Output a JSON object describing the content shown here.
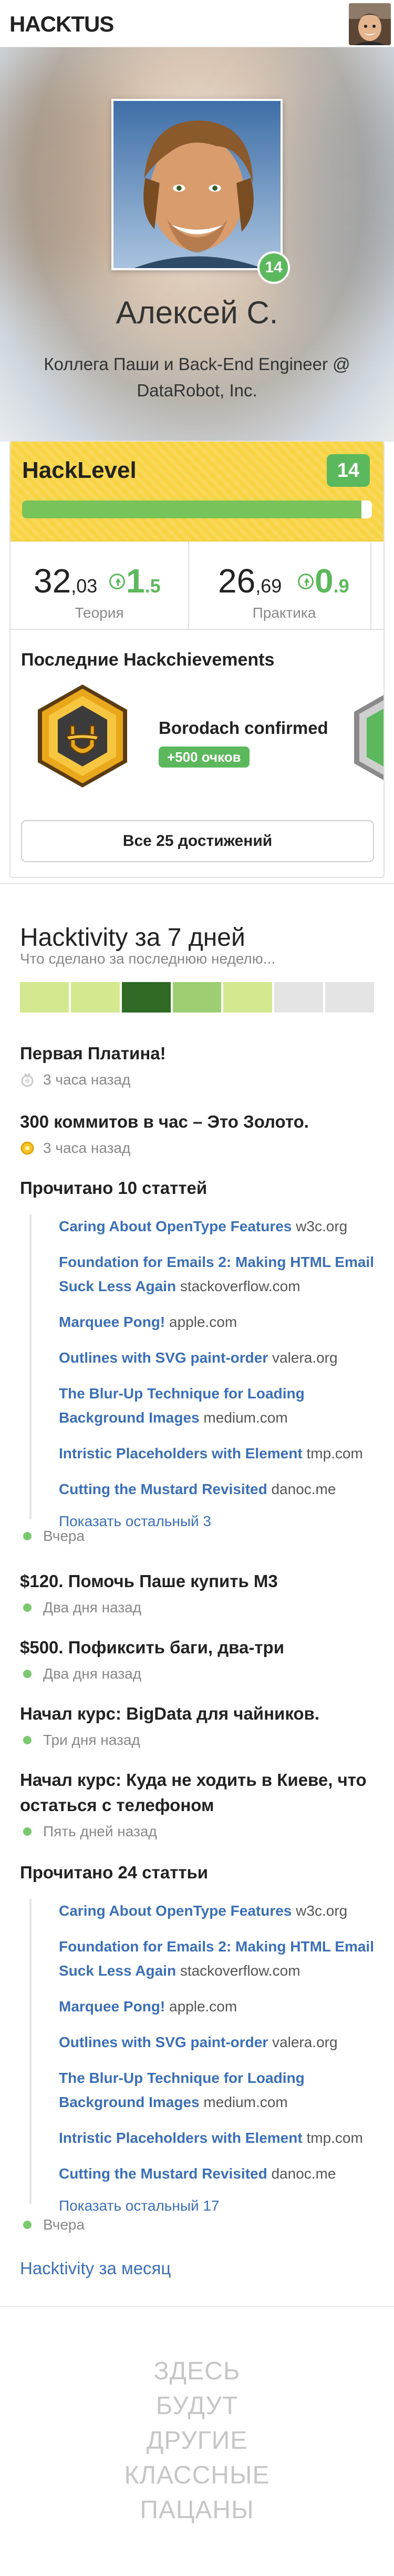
{
  "app": {
    "logo": "HACKTUS"
  },
  "profile": {
    "name": "Алексей С.",
    "role": "Коллега Паши и Back-End Engineer @ DataRobot, Inc.",
    "level": "14"
  },
  "hacklevel": {
    "title": "HackLevel",
    "level": "14",
    "progress_fraction": 0.97,
    "progress_color": "#78c35a",
    "stats": [
      {
        "int": "32",
        "dec": ",03",
        "delta_int": "1",
        "delta_dec": ".5",
        "label": "Теория"
      },
      {
        "int": "26",
        "dec": ",69",
        "delta_int": "0",
        "delta_dec": ".9",
        "label": "Практика"
      }
    ]
  },
  "achievements": {
    "title": "Последние Hackchievements",
    "items": [
      {
        "name": "Borodach  confirmed",
        "points": "+500 очков"
      }
    ],
    "all_button": "Все 25 достижений"
  },
  "hacktivity": {
    "title": "Hacktivity за 7 дней",
    "subtitle": "Что сделано за последнюю неделю...",
    "heatmap": [
      "#d4e98f",
      "#d4e98f",
      "#2f6a24",
      "#9dcf72",
      "#d4e98f",
      "#e4e4e4",
      "#e4e4e4"
    ],
    "events": [
      {
        "title": "Первая Платина!",
        "time": "3 часа назад",
        "icon": "platinum-medal-icon"
      },
      {
        "title": "300 коммитов в час – Это Золото.",
        "time": "3 часа назад",
        "icon": "gold-medal-icon"
      },
      {
        "title": "Прочитано 10 статтей",
        "time": "Вчера",
        "icon": "green-dot-icon"
      },
      {
        "title": "$120. Помочь Паше купить М3",
        "time": "Два дня назад",
        "icon": "green-dot-icon"
      },
      {
        "title": "$500. Пофиксить баги, два-три",
        "time": "Два дня назад",
        "icon": "green-dot-icon"
      },
      {
        "title": "Начал курс: BigData для чайников.",
        "time": "Три дня назад",
        "icon": "green-dot-icon"
      },
      {
        "title": "Начал курс: Куда не ходить в Киеве, что остаться с телефоном",
        "time": "Пять дней назад",
        "icon": "green-dot-icon"
      },
      {
        "title": "Прочитано 24 статтьи",
        "time": "Вчера",
        "icon": "green-dot-icon"
      }
    ],
    "reading_1": [
      {
        "title": "Caring About OpenType Features",
        "host": "w3c.org"
      },
      {
        "title": "Foundation for Emails 2: Making HTML Email Suck Less Again",
        "host": "stackoverflow.com"
      },
      {
        "title": "Marquee Pong!",
        "host": "apple.com"
      },
      {
        "title": "Outlines with SVG paint-order",
        "host": "valera.org"
      },
      {
        "title": "The Blur-Up Technique for Loading Background Images",
        "host": "medium.com"
      },
      {
        "title": "Intristic Placeholders with Element",
        "host": "tmp.com"
      },
      {
        "title": "Cutting the Mustard Revisited",
        "host": "danoc.me"
      }
    ],
    "reading_1_more": "Показать остальный 3",
    "reading_2": [
      {
        "title": "Caring About OpenType Features",
        "host": "w3c.org"
      },
      {
        "title": "Foundation for Emails 2: Making HTML Email Suck Less Again",
        "host": "stackoverflow.com"
      },
      {
        "title": "Marquee Pong!",
        "host": "apple.com"
      },
      {
        "title": "Outlines with SVG paint-order",
        "host": "valera.org"
      },
      {
        "title": "The Blur-Up Technique for Loading Background Images",
        "host": "medium.com"
      },
      {
        "title": "Intristic Placeholders with Element",
        "host": "tmp.com"
      },
      {
        "title": "Cutting the Mustard Revisited",
        "host": "danoc.me"
      }
    ],
    "reading_2_more": "Показать остальный 17",
    "month_link": "Hacktivity за месяц"
  },
  "promo": {
    "lines": [
      "ЗДЕСЬ",
      "БУДУТ",
      "ДРУГИЕ",
      "КЛАССНЫЕ",
      "ПАЦАНЫ"
    ]
  },
  "colors": {
    "accent": "#5cb85c",
    "link": "#3b6fb6",
    "header_yellow": "#f8d444"
  }
}
